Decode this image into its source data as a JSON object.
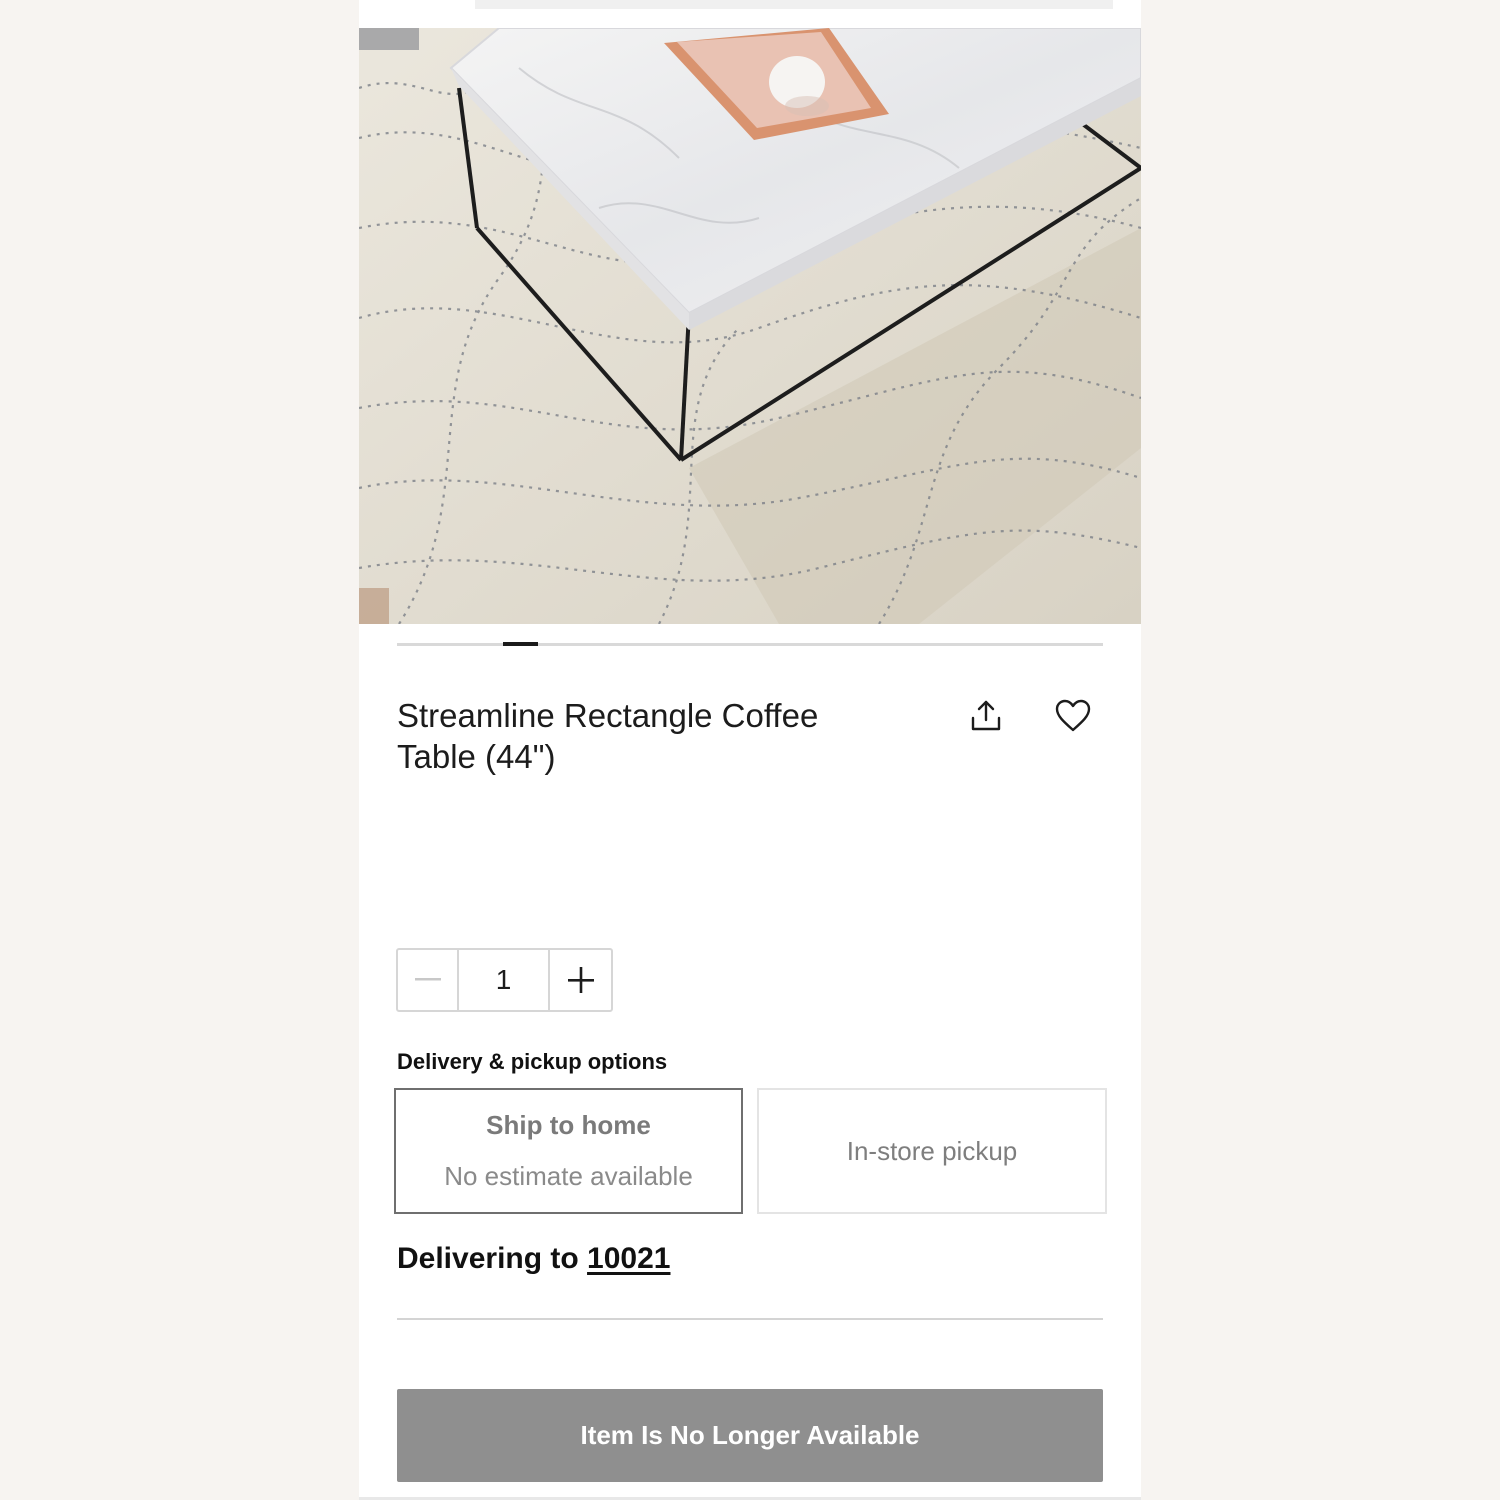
{
  "product": {
    "title": "Streamline Rectangle Coffee Table (44\")",
    "image_alt": "Streamline rectangle coffee table with marble top and black frame on a patterned rug"
  },
  "carousel": {
    "slide_count": 7,
    "active_index": 1
  },
  "actions": {
    "share_icon": "share-icon",
    "favorite_icon": "heart-icon"
  },
  "quantity": {
    "value": "1",
    "minus_icon": "minus-icon",
    "plus_icon": "plus-icon"
  },
  "delivery": {
    "heading": "Delivery & pickup options",
    "options": [
      {
        "title": "Ship to home",
        "subtitle": "No estimate available",
        "selected": true
      },
      {
        "title": "In-store pickup",
        "selected": false
      }
    ],
    "delivering_label": "Delivering to",
    "zip": "10021"
  },
  "cta": {
    "label": "Item Is No Longer Available",
    "color": "#8f8f8f"
  }
}
